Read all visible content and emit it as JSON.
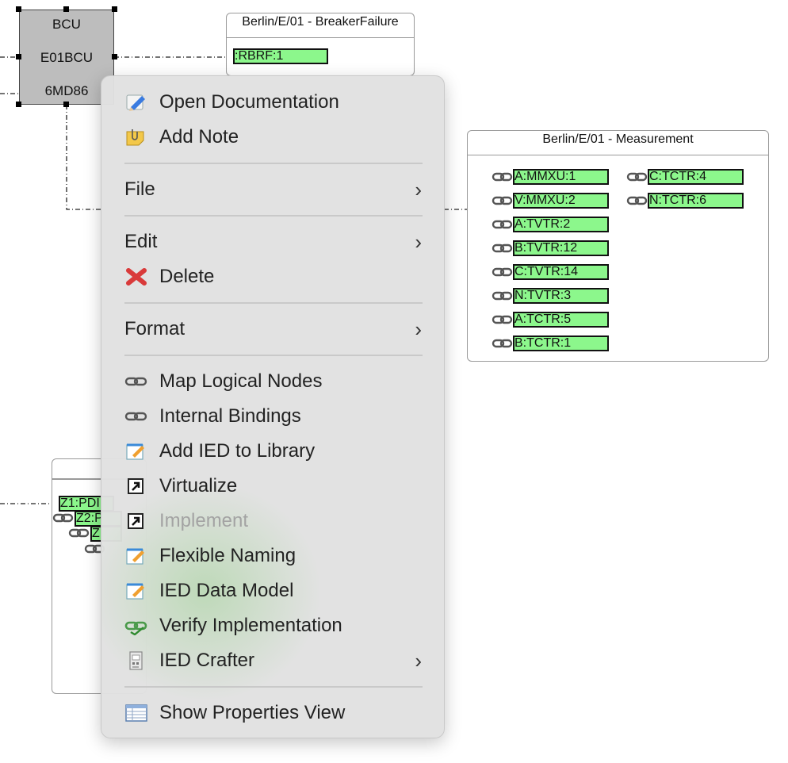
{
  "ied": {
    "line1": "BCU",
    "line2": "E01BCU",
    "line3": "6MD86"
  },
  "breaker_box": {
    "title": "Berlin/E/01 - BreakerFailure",
    "node": ":RBRF:1"
  },
  "measurement_box": {
    "title": "Berlin/E/01 - Measurement",
    "col1": [
      "A:MMXU:1",
      "V:MMXU:2",
      "A:TVTR:2",
      "B:TVTR:12",
      "C:TVTR:14",
      "N:TVTR:3",
      "A:TCTR:5",
      "B:TCTR:1"
    ],
    "col2": [
      "C:TCTR:4",
      "N:TCTR:6"
    ]
  },
  "protection_box": {
    "nodes": [
      "Z1:PDI",
      "Z2:P",
      "Z"
    ]
  },
  "menu": {
    "open_documentation": "Open Documentation",
    "add_note": "Add Note",
    "file": "File",
    "edit": "Edit",
    "delete": "Delete",
    "format": "Format",
    "map_logical_nodes": "Map Logical Nodes",
    "internal_bindings": "Internal Bindings",
    "add_ied_to_library": "Add IED to Library",
    "virtualize": "Virtualize",
    "implement": "Implement",
    "flexible_naming": "Flexible Naming",
    "ied_data_model": "IED Data Model",
    "verify_implementation": "Verify Implementation",
    "ied_crafter": "IED Crafter",
    "show_properties_view": "Show Properties View",
    "submenu_chevron": "›"
  },
  "icons": {
    "open_documentation": "pencil-icon",
    "add_note": "note-icon",
    "delete": "red-x-icon",
    "map_logical_nodes": "chain-link-icon",
    "internal_bindings": "chain-link-icon",
    "add_ied_to_library": "edit-pad-icon",
    "virtualize": "shortcut-arrow-icon",
    "implement": "shortcut-arrow-icon",
    "flexible_naming": "edit-pad-icon",
    "ied_data_model": "edit-pad-icon",
    "verify_implementation": "green-link-icon",
    "ied_crafter": "device-icon",
    "show_properties_view": "table-icon"
  },
  "colors": {
    "node_fill": "#8cf78c",
    "ied_fill": "#bdbdbd",
    "menu_bg": "#e1e1e1",
    "disabled_text": "#a3a3a3"
  }
}
